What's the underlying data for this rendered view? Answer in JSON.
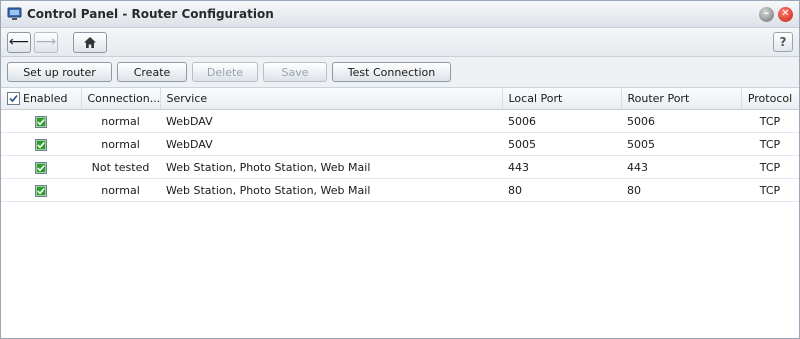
{
  "window": {
    "title": "Control Panel - Router Configuration",
    "help_label": "?"
  },
  "toolbar": {
    "buttons": [
      {
        "label": "Set up router",
        "enabled": true
      },
      {
        "label": "Create",
        "enabled": true
      },
      {
        "label": "Delete",
        "enabled": false
      },
      {
        "label": "Save",
        "enabled": false
      },
      {
        "label": "Test Connection",
        "enabled": true
      }
    ]
  },
  "table": {
    "columns": [
      "Enabled",
      "Connection...",
      "Service",
      "Local Port",
      "Router Port",
      "Protocol"
    ],
    "rows": [
      {
        "enabled": true,
        "connection": "normal",
        "service": "WebDAV",
        "local_port": "5006",
        "router_port": "5006",
        "protocol": "TCP"
      },
      {
        "enabled": true,
        "connection": "normal",
        "service": "WebDAV",
        "local_port": "5005",
        "router_port": "5005",
        "protocol": "TCP"
      },
      {
        "enabled": true,
        "connection": "Not tested",
        "service": "Web Station, Photo Station, Web Mail",
        "local_port": "443",
        "router_port": "443",
        "protocol": "TCP"
      },
      {
        "enabled": true,
        "connection": "normal",
        "service": "Web Station, Photo Station, Web Mail",
        "local_port": "80",
        "router_port": "80",
        "protocol": "TCP"
      }
    ]
  },
  "colors": {
    "check_green": "#2f9e2f",
    "close_red": "#d0321f"
  }
}
